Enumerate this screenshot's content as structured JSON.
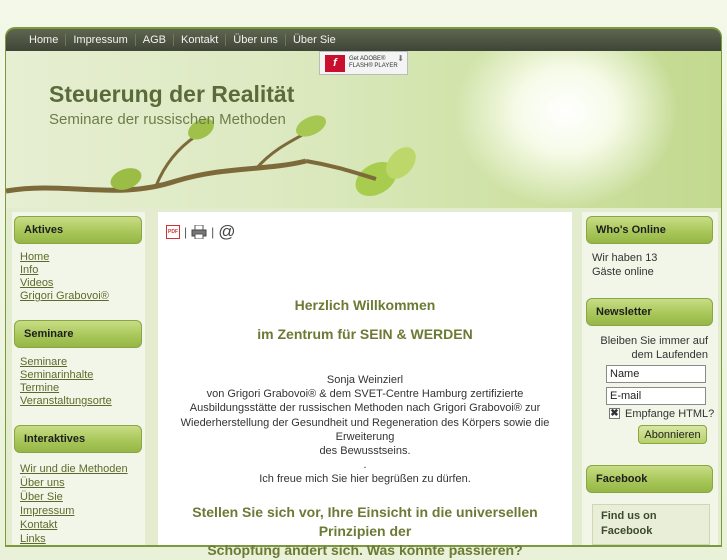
{
  "nav": {
    "items": [
      "Home",
      "Impressum",
      "AGB",
      "Kontakt",
      "Über uns",
      "Über Sie"
    ]
  },
  "header": {
    "title": "Steuerung der Realität",
    "subtitle": "Seminare der russischen Methoden",
    "flash_badge": {
      "line1": "Get ADOBE®",
      "line2": "FLASH® PLAYER"
    }
  },
  "left": {
    "aktives": {
      "title": "Aktives",
      "links": [
        "Home",
        "Info",
        "Videos",
        "Grigori Grabovoi®"
      ]
    },
    "seminare": {
      "title": "Seminare",
      "links": [
        "Seminare",
        "Seminarinhalte",
        "Termine",
        "Veranstaltungsorte"
      ]
    },
    "interaktives": {
      "title": "Interaktives",
      "links": [
        "Wir und die Methoden",
        "Über uns",
        "Über Sie",
        "Impressum",
        "Kontakt",
        "Links"
      ]
    }
  },
  "main": {
    "icon_separator": "|",
    "welcome1": "Herzlich Willkommen",
    "welcome2": "im Zentrum für SEIN & WERDEN",
    "lines": [
      "Sonja Weinzierl",
      "von Grigori Grabovoi® & dem SVET-Centre Hamburg zertifizierte",
      "Ausbildungsstätte der russischen Methoden nach Grigori Grabovoi® zur",
      "Wiederherstellung der Gesundheit und Regeneration des Körpers sowie die Erweiterung",
      "des Bewusstseins.",
      ".",
      "Ich freue mich Sie hier begrüßen zu dürfen."
    ],
    "question_line1": "Stellen Sie sich vor, Ihre Einsicht in die universellen Prinzipien der",
    "question_line2": "Schöpfung ändert sich. Was könnte passieren?"
  },
  "right": {
    "whos_online": {
      "title": "Who's Online",
      "line1": "Wir haben 13",
      "line2": "Gäste online"
    },
    "newsletter": {
      "title": "Newsletter",
      "text1": "Bleiben Sie immer auf",
      "text2": "dem Laufenden",
      "name_placeholder": "Name",
      "email_placeholder": "E-mail",
      "checkbox_label": "Empfange HTML?",
      "checkbox_mark": "✖",
      "button_label": "Abonnieren"
    },
    "facebook": {
      "title": "Facebook",
      "line1": "Find us on",
      "line2": "Facebook"
    }
  },
  "colors": {
    "accent": "#a9c75a",
    "heading": "#6b7a34",
    "nav_bg": "#454b3b",
    "link": "#5b6b2c"
  }
}
